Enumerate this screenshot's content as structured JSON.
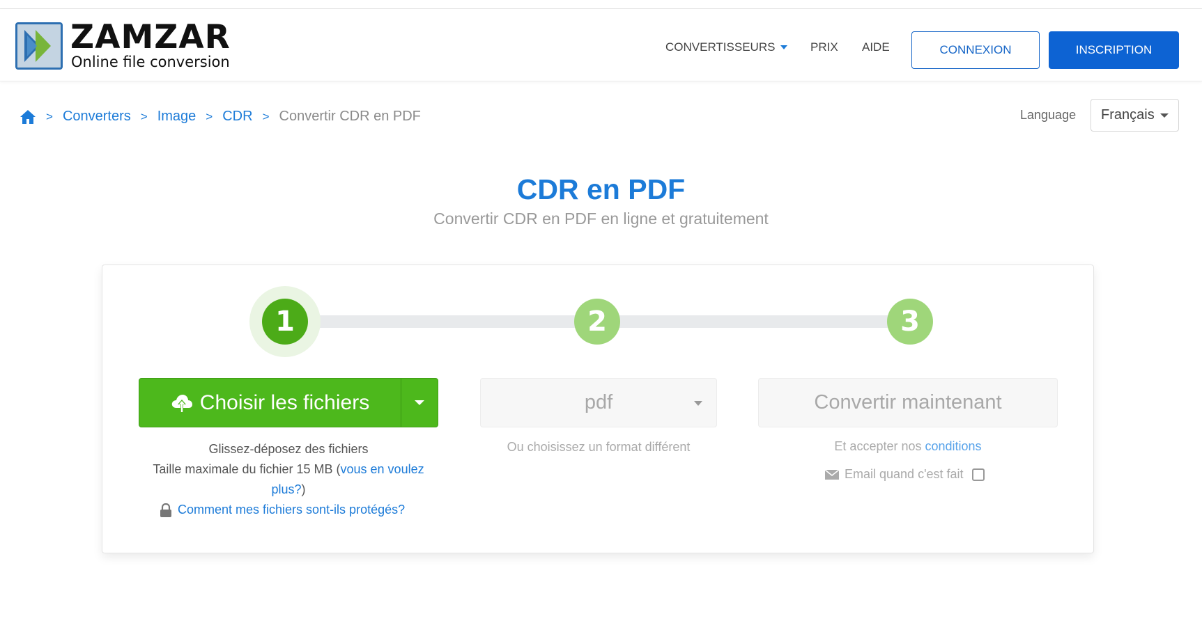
{
  "header": {
    "logo_word": "ZAMZAR",
    "logo_tm": "™",
    "logo_tagline": "Online file conversion",
    "nav": {
      "converters": "CONVERTISSEURS",
      "pricing": "PRIX",
      "help": "AIDE"
    },
    "login_label": "CONNEXION",
    "signup_label": "INSCRIPTION"
  },
  "breadcrumb": {
    "items": [
      "Converters",
      "Image",
      "CDR"
    ],
    "separator": ">",
    "current": "Convertir CDR en PDF"
  },
  "language": {
    "label": "Language",
    "selected": "Français"
  },
  "page": {
    "title": "CDR en PDF",
    "subtitle": "Convertir CDR en PDF en ligne et gratuitement"
  },
  "steps": {
    "step1_number": "1",
    "step2_number": "2",
    "step3_number": "3"
  },
  "upload": {
    "button_label": "Choisir les fichiers",
    "drag_hint": "Glissez-déposez des fichiers",
    "max_size_text": "Taille maximale du fichier 15 MB (",
    "max_size_link": "vous en voulez plus?",
    "max_size_close": ")",
    "secure_link": "Comment mes fichiers sont-ils protégés?"
  },
  "format": {
    "selected": "pdf",
    "hint": "Ou choisissez un format différent"
  },
  "convert": {
    "button_label": "Convertir maintenant",
    "accept_text": "Et accepter nos ",
    "conditions_link": "conditions",
    "email_label": "Email quand c'est fait"
  },
  "colors": {
    "brand_blue": "#1c7bd8",
    "primary_button": "#0d63d3",
    "green": "#4db81c",
    "light_green": "#9fd67a"
  },
  "icons": {
    "home": "home-icon",
    "upload": "cloud-upload-icon",
    "lock": "lock-icon",
    "email": "envelope-icon"
  }
}
